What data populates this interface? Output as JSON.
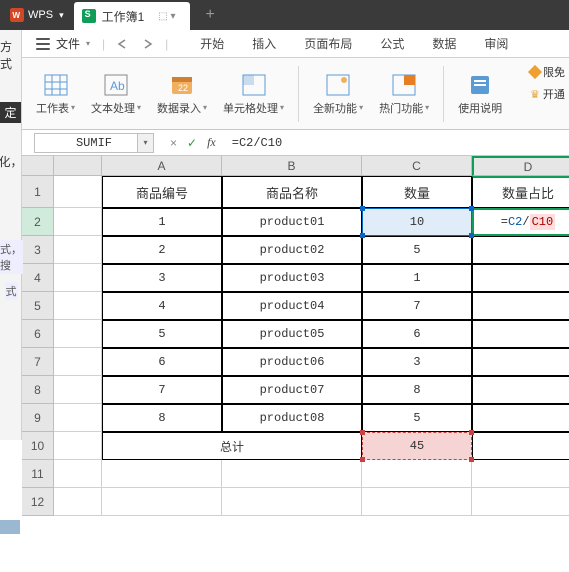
{
  "titlebar": {
    "app_label": "WPS",
    "doc_name": "工作簿1",
    "doc_controls": "⬚   ▾",
    "new_tab": "+"
  },
  "left_panel": {
    "row1": "方式",
    "row2": "定",
    "row3": "化，",
    "row4": "式，搜",
    "row5": "式"
  },
  "ribbon": {
    "file": "文件",
    "tabs": [
      "开始",
      "插入",
      "页面布局",
      "公式",
      "数据",
      "审阅"
    ]
  },
  "toolbar": {
    "worksheet": "工作表",
    "text_proc": "文本处理",
    "data_entry": "数据录入",
    "cell_proc": "单元格处理",
    "new_feat": "全新功能",
    "hot_feat": "热门功能",
    "help": "使用说明",
    "vip_only": "限免",
    "open_vip": "开通"
  },
  "formula_bar": {
    "name_box": "SUMIF",
    "cancel": "×",
    "confirm": "✓",
    "fx": "fx",
    "formula": "=C2/C10"
  },
  "columns": [
    "A",
    "B",
    "C",
    "D"
  ],
  "headers": {
    "A": "商品编号",
    "B": "商品名称",
    "C": "数量",
    "D": "数量占比"
  },
  "rows": [
    {
      "r": "1"
    },
    {
      "r": "2",
      "A": "1",
      "B": "product01",
      "C": "10",
      "D_prefix": "=",
      "D_ref1": "C2",
      "D_mid": "/",
      "D_ref2": "C10"
    },
    {
      "r": "3",
      "A": "2",
      "B": "product02",
      "C": "5"
    },
    {
      "r": "4",
      "A": "3",
      "B": "product03",
      "C": "1"
    },
    {
      "r": "5",
      "A": "4",
      "B": "product04",
      "C": "7"
    },
    {
      "r": "6",
      "A": "5",
      "B": "product05",
      "C": "6"
    },
    {
      "r": "7",
      "A": "6",
      "B": "product06",
      "C": "3"
    },
    {
      "r": "8",
      "A": "7",
      "B": "product07",
      "C": "8"
    },
    {
      "r": "9",
      "A": "8",
      "B": "product08",
      "C": "5"
    },
    {
      "r": "10",
      "AB": "总计",
      "C": "45"
    },
    {
      "r": "11"
    },
    {
      "r": "12"
    }
  ]
}
